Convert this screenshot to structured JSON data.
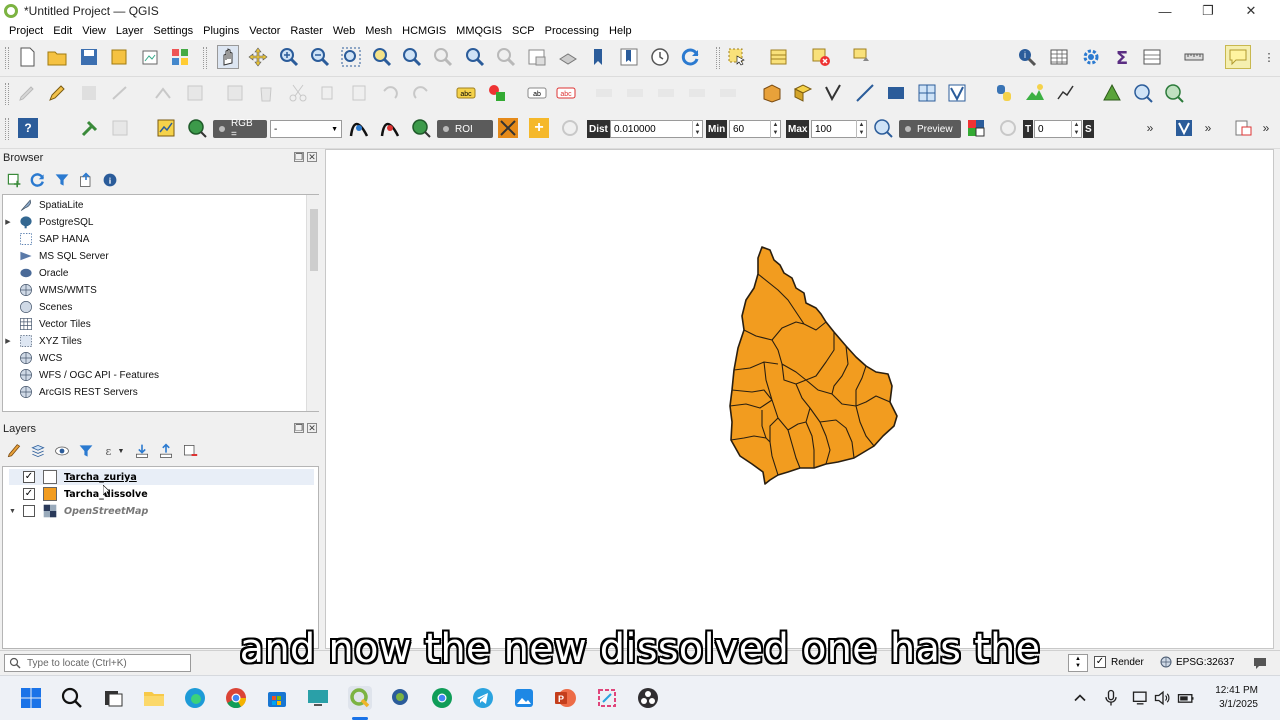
{
  "window": {
    "title": "*Untitled Project — QGIS",
    "controls": {
      "minimize": "—",
      "maximize": "❐",
      "close": "✕"
    }
  },
  "menubar": {
    "items": [
      "Project",
      "Edit",
      "View",
      "Layer",
      "Settings",
      "Plugins",
      "Vector",
      "Raster",
      "Web",
      "Mesh",
      "HCMGIS",
      "MMQGIS",
      "SCP",
      "Processing",
      "Help"
    ]
  },
  "scp_toolbar": {
    "help_label": "?",
    "rgb_label": "RGB =",
    "rgb_value": "-",
    "roi_label": "ROI",
    "dist_label": "Dist",
    "dist_value": "0.010000",
    "min_label": "Min",
    "min_value": "60",
    "max_label": "Max",
    "max_value": "100",
    "preview_label": "Preview",
    "t_label": "T",
    "t_value": "0",
    "s_label": "S",
    "overflow": "»"
  },
  "browser": {
    "title": "Browser",
    "items": [
      {
        "label": "SpatiaLite",
        "icon": "feather-icon",
        "expandable": false
      },
      {
        "label": "PostgreSQL",
        "icon": "elephant-icon",
        "expandable": true
      },
      {
        "label": "SAP HANA",
        "icon": "grid-db-icon",
        "expandable": false
      },
      {
        "label": "MS SQL Server",
        "icon": "mssql-icon",
        "expandable": false
      },
      {
        "label": "Oracle",
        "icon": "oracle-icon",
        "expandable": false
      },
      {
        "label": "WMS/WMTS",
        "icon": "globe-icon",
        "expandable": false
      },
      {
        "label": "Scenes",
        "icon": "cube-icon",
        "expandable": false
      },
      {
        "label": "Vector Tiles",
        "icon": "vector-tiles-icon",
        "expandable": false
      },
      {
        "label": "XYZ Tiles",
        "icon": "xyz-tiles-icon",
        "expandable": true
      },
      {
        "label": "WCS",
        "icon": "globe-icon",
        "expandable": false
      },
      {
        "label": "WFS / OGC API - Features",
        "icon": "globe-icon",
        "expandable": false
      },
      {
        "label": "ArcGIS REST Servers",
        "icon": "globe-icon",
        "expandable": false
      }
    ]
  },
  "layers": {
    "title": "Layers",
    "items": [
      {
        "name": "Tarcha_zuriya",
        "checked": true,
        "swatch": "#ffffff",
        "style": "bold"
      },
      {
        "name": "Tarcha_dissolve",
        "checked": true,
        "swatch": "#f29c1f",
        "style": "bold"
      },
      {
        "name": "OpenStreetMap",
        "checked": false,
        "swatch": "",
        "style": "italic"
      }
    ]
  },
  "map": {
    "fill_color": "#f29c1f",
    "stroke_color": "#2a1f10",
    "background": "#ffffff"
  },
  "statusbar": {
    "locator_placeholder": "Type to locate (Ctrl+K)",
    "render_label": "Render",
    "crs_label": "EPSG:32637"
  },
  "subtitle": "and now the new dissolved one has the",
  "taskbar": {
    "time": "12:41 PM",
    "date": "3/1/2025"
  },
  "colors": {
    "accent": "#f29c1f",
    "toolbar_bg": "#f0f0f0",
    "taskbar_bg": "#eef1f6"
  }
}
